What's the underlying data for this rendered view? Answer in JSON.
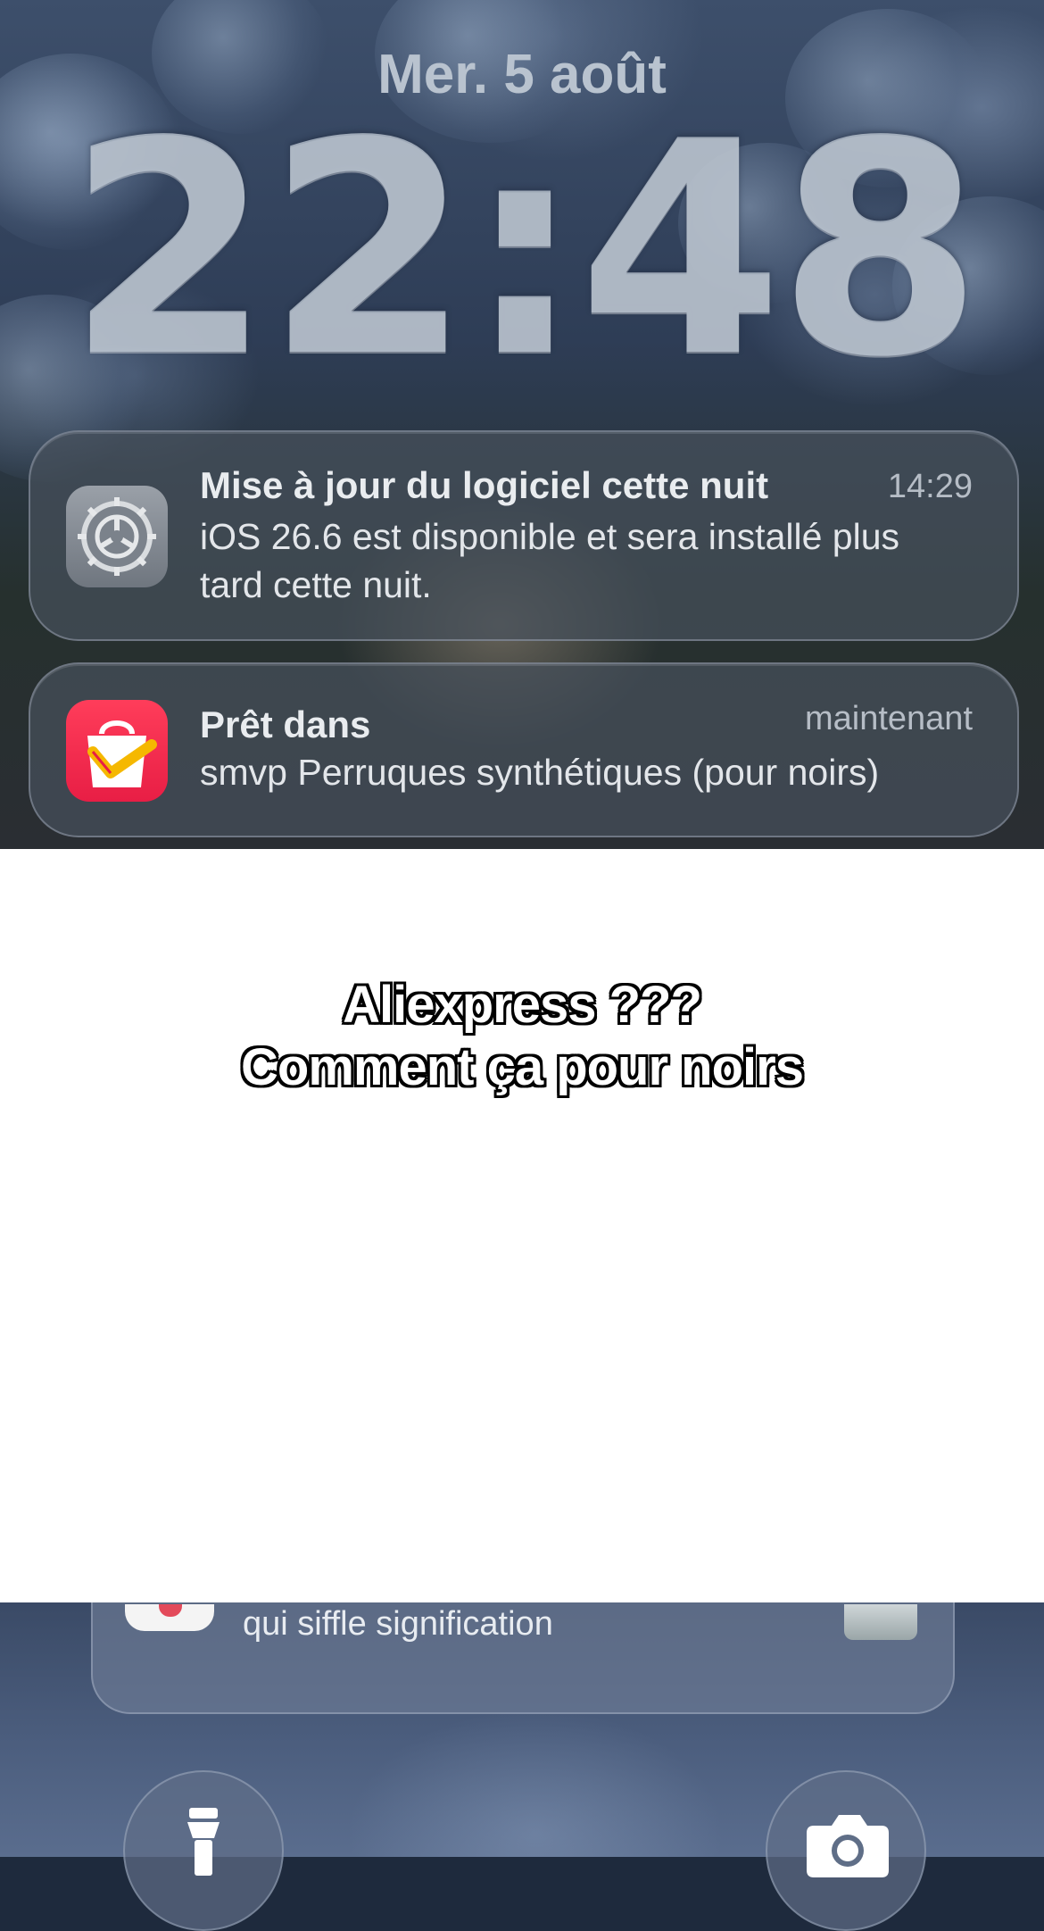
{
  "lock_screen": {
    "date": "Mer. 5 août",
    "time": "22:48"
  },
  "notifications": [
    {
      "app_icon": "settings-gear-icon",
      "title": "Mise à jour du logiciel cette nuit",
      "time": "14:29",
      "body": "iOS 26.6 est disponible et sera installé plus tard cette nuit."
    },
    {
      "app_icon": "shopping-bag-check-icon",
      "title": "Prêt dans",
      "time": "maintenant",
      "body": "smvp Perruques synthétiques (pour noirs)"
    },
    {
      "app_icon": "news-app-icon",
      "title": "",
      "time": "",
      "body": "qui siffle signification"
    }
  ],
  "caption": {
    "line1": "Aliexpress ???",
    "line2": "Comment ça pour noirs"
  },
  "quick_actions": {
    "left": "flashlight-icon",
    "right": "camera-icon"
  },
  "colors": {
    "caption_fill": "#ffffff",
    "caption_outline": "#000000",
    "overlay_panel": "#ffffff",
    "aliexpress_icon": "#e81e45",
    "settings_icon": "#8a9098"
  }
}
